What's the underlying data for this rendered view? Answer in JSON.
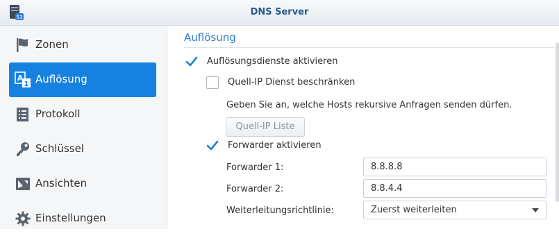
{
  "window": {
    "title": "DNS Server"
  },
  "sidebar": {
    "items": [
      {
        "label": "Zonen",
        "icon": "flag-icon"
      },
      {
        "label": "Auflösung",
        "icon": "resolution-icon",
        "active": true
      },
      {
        "label": "Protokoll",
        "icon": "log-icon"
      },
      {
        "label": "Schlüssel",
        "icon": "key-icon"
      },
      {
        "label": "Ansichten",
        "icon": "views-icon"
      },
      {
        "label": "Einstellungen",
        "icon": "gear-icon"
      }
    ]
  },
  "main": {
    "section_title": "Auflösung",
    "resolution_services": {
      "label": "Auflösungsdienste aktivieren",
      "checked": true
    },
    "limit_source_ip": {
      "label": "Quell-IP Dienst beschränken",
      "checked": false
    },
    "hint": "Geben Sie an, welche Hosts rekursive Anfragen senden dürfen.",
    "source_ip_list_button": "Quell-IP Liste",
    "forwarder_enable": {
      "label": "Forwarder aktivieren",
      "checked": true
    },
    "forwarder1": {
      "label": "Forwarder 1:",
      "value": "8.8.8.8"
    },
    "forwarder2": {
      "label": "Forwarder 2:",
      "value": "8.8.4.4"
    },
    "policy": {
      "label": "Weiterleitungsrichtlinie:",
      "value": "Zuerst weiterleiten"
    }
  },
  "colors": {
    "accent": "#1781e2",
    "checkmark": "#1f7fd8",
    "section_title": "#2e7bd1"
  }
}
